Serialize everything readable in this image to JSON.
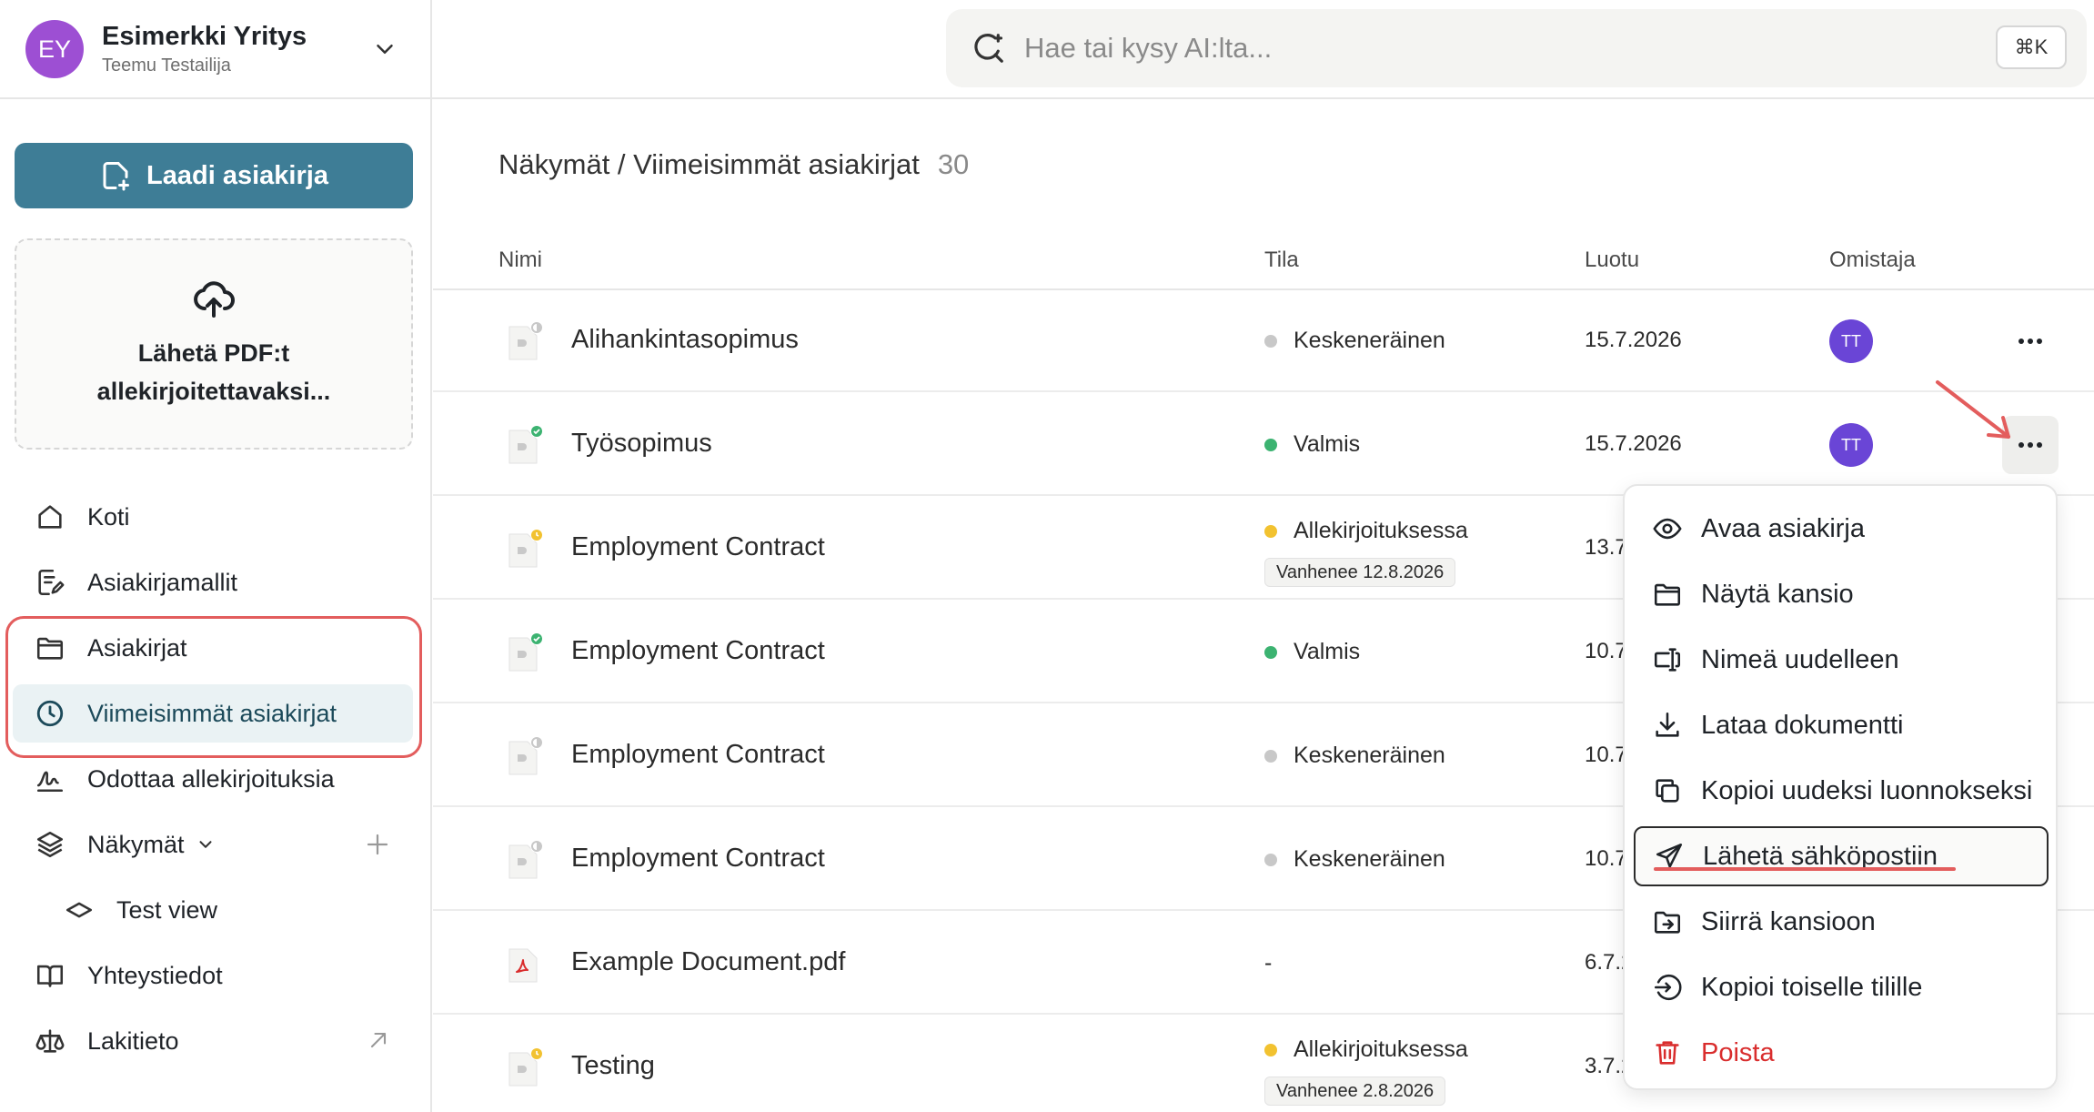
{
  "account": {
    "initials": "EY",
    "company": "Esimerkki Yritys",
    "user": "Teemu Testailija"
  },
  "search": {
    "placeholder": "Hae tai kysy AI:lta...",
    "shortcut": "⌘K"
  },
  "sidebar": {
    "create_button": "Laadi asiakirja",
    "upload_label": "Lähetä PDF:t allekirjoitettavaksi...",
    "items": [
      {
        "label": "Koti",
        "icon": "home-icon"
      },
      {
        "label": "Asiakirjamallit",
        "icon": "template-icon"
      },
      {
        "label": "Asiakirjat",
        "icon": "folder-icon"
      },
      {
        "label": "Viimeisimmät asiakirjat",
        "icon": "clock-icon",
        "active": true
      },
      {
        "label": "Odottaa allekirjoituksia",
        "icon": "signature-icon"
      },
      {
        "label": "Näkymät",
        "icon": "layers-icon"
      },
      {
        "label": "Test view",
        "icon": "diamond-icon"
      },
      {
        "label": "Yhteystiedot",
        "icon": "book-icon"
      },
      {
        "label": "Lakitieto",
        "icon": "scale-icon"
      }
    ]
  },
  "main": {
    "breadcrumb": "Näkymät / Viimeisimmät asiakirjat",
    "count": "30",
    "columns": [
      "Nimi",
      "Tila",
      "Luotu",
      "Omistaja"
    ],
    "rows": [
      {
        "name": "Alihankintasopimus",
        "status": "Keskeneräinen",
        "status_kind": "draft",
        "expiry": "",
        "created": "15.7.2026",
        "owner": "TT"
      },
      {
        "name": "Työsopimus",
        "status": "Valmis",
        "status_kind": "done",
        "expiry": "",
        "created": "15.7.2026",
        "owner": "TT"
      },
      {
        "name": "Employment Contract",
        "status": "Allekirjoituksessa",
        "status_kind": "signing",
        "expiry": "Vanhenee 12.8.2026",
        "created": "13.7",
        "owner": ""
      },
      {
        "name": "Employment Contract",
        "status": "Valmis",
        "status_kind": "done",
        "expiry": "",
        "created": "10.7",
        "owner": ""
      },
      {
        "name": "Employment Contract",
        "status": "Keskeneräinen",
        "status_kind": "draft",
        "expiry": "",
        "created": "10.7",
        "owner": ""
      },
      {
        "name": "Employment Contract",
        "status": "Keskeneräinen",
        "status_kind": "draft",
        "expiry": "",
        "created": "10.7",
        "owner": ""
      },
      {
        "name": "Example Document.pdf",
        "status": "-",
        "status_kind": "none",
        "expiry": "",
        "created": "6.7.2",
        "owner": ""
      },
      {
        "name": "Testing",
        "status": "Allekirjoituksessa",
        "status_kind": "signing",
        "expiry": "Vanhenee 2.8.2026",
        "created": "3.7.2",
        "owner": ""
      }
    ]
  },
  "context_menu": {
    "items": [
      {
        "label": "Avaa asiakirja",
        "icon": "eye-icon"
      },
      {
        "label": "Näytä kansio",
        "icon": "folder-icon"
      },
      {
        "label": "Nimeä uudelleen",
        "icon": "rename-icon"
      },
      {
        "label": "Lataa dokumentti",
        "icon": "download-icon"
      },
      {
        "label": "Kopioi uudeksi luonnokseksi",
        "icon": "copy-icon"
      },
      {
        "label": "Lähetä sähköpostiin",
        "icon": "send-icon",
        "selected": true
      },
      {
        "label": "Siirrä kansioon",
        "icon": "move-folder-icon"
      },
      {
        "label": "Kopioi toiselle tilille",
        "icon": "copy-account-icon"
      },
      {
        "label": "Poista",
        "icon": "trash-icon",
        "danger": true
      }
    ]
  },
  "colors": {
    "primary": "#3e7d96",
    "avatar_company": "#9d4fd3",
    "avatar_owner": "#6a45d6",
    "status_draft": "#c8c8c8",
    "status_done": "#3cb371",
    "status_signing": "#f2c230",
    "danger": "#d92d2d",
    "annotation": "#e35d5d"
  }
}
